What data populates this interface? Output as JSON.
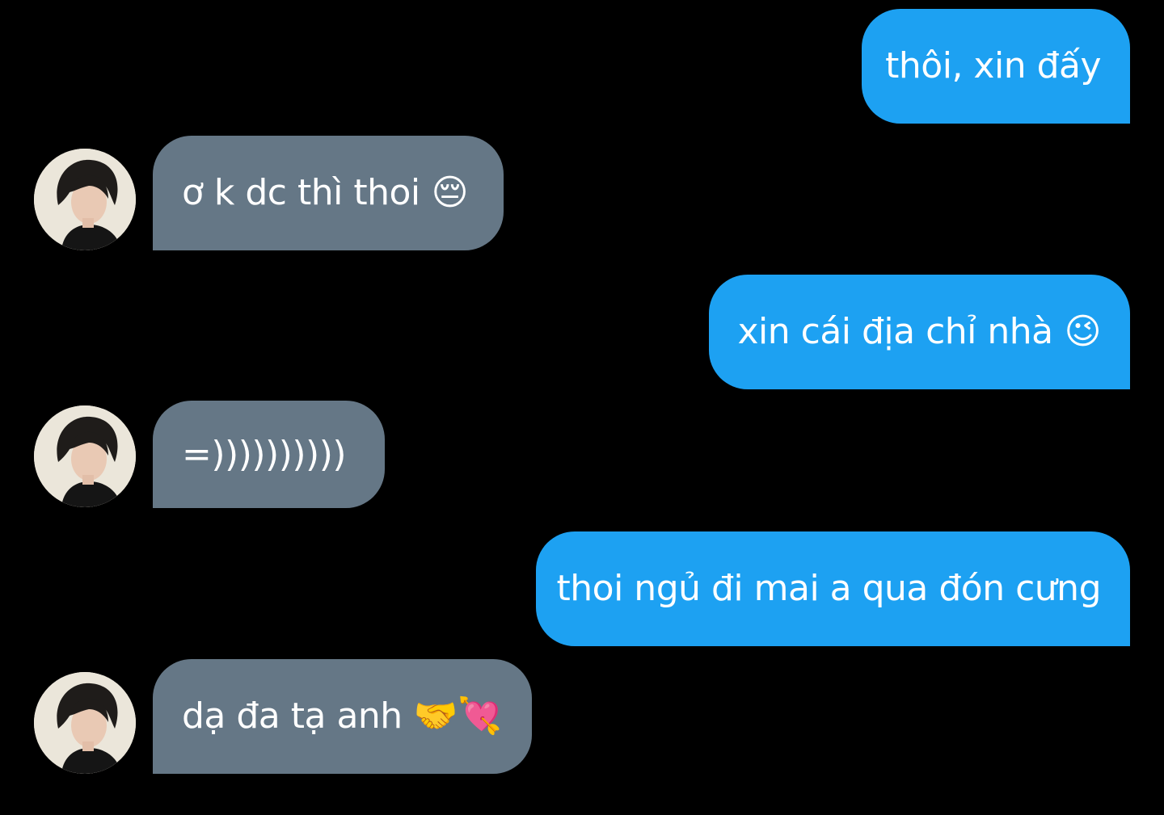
{
  "colors": {
    "background": "#000000",
    "outgoing_bubble": "#1DA1F2",
    "incoming_bubble": "#657786",
    "text": "#ffffff"
  },
  "messages": [
    {
      "direction": "outgoing",
      "text": "thôi, xin đấy",
      "emoji": ""
    },
    {
      "direction": "incoming",
      "text": "ơ k dc thì thoi",
      "emoji": "😔",
      "emoji_name": "pensive-face-icon"
    },
    {
      "direction": "outgoing",
      "text": "xin cái địa chỉ nhà",
      "emoji": "😉",
      "emoji_name": "winking-face-icon"
    },
    {
      "direction": "incoming",
      "text": "=))))))))))",
      "emoji": ""
    },
    {
      "direction": "outgoing",
      "text": "thoi ngủ đi mai a qua đón cưng",
      "emoji": ""
    },
    {
      "direction": "incoming",
      "text": "dạ đa tạ anh",
      "emoji": "🤝💘",
      "emoji_name": "handshake-heart-arrow-icon"
    }
  ]
}
